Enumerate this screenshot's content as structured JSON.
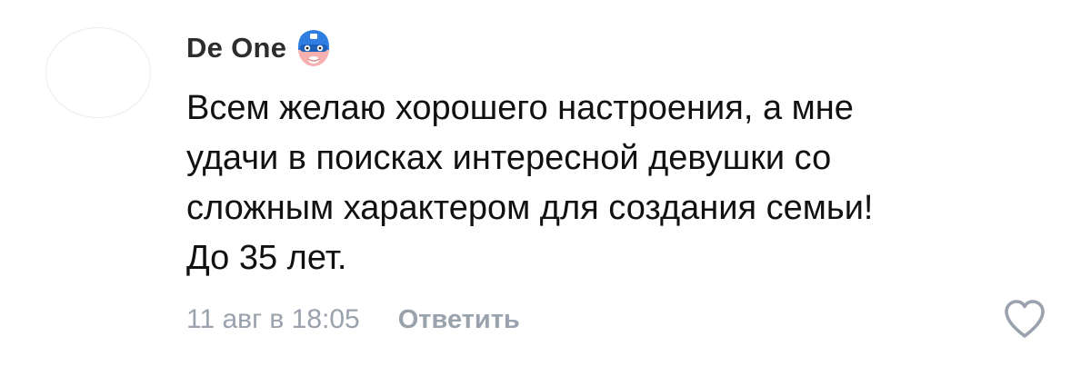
{
  "comment": {
    "author": "De One",
    "badge_icon": "masked-hero-avatar-icon",
    "text": "Всем желаю хорошего настроения, а мне\nудачи в поисках интересной девушки со\nсложным характером для создания семьи!\nДо 35 лет.",
    "timestamp": "11 авг в 18:05",
    "reply_label": "Ответить",
    "like_icon": "heart-outline-icon"
  },
  "colors": {
    "text": "#111111",
    "author": "#2c2d2e",
    "muted": "#99a2ad",
    "badge_blue": "#2f7de1",
    "badge_skin": "#f6b0b0"
  }
}
